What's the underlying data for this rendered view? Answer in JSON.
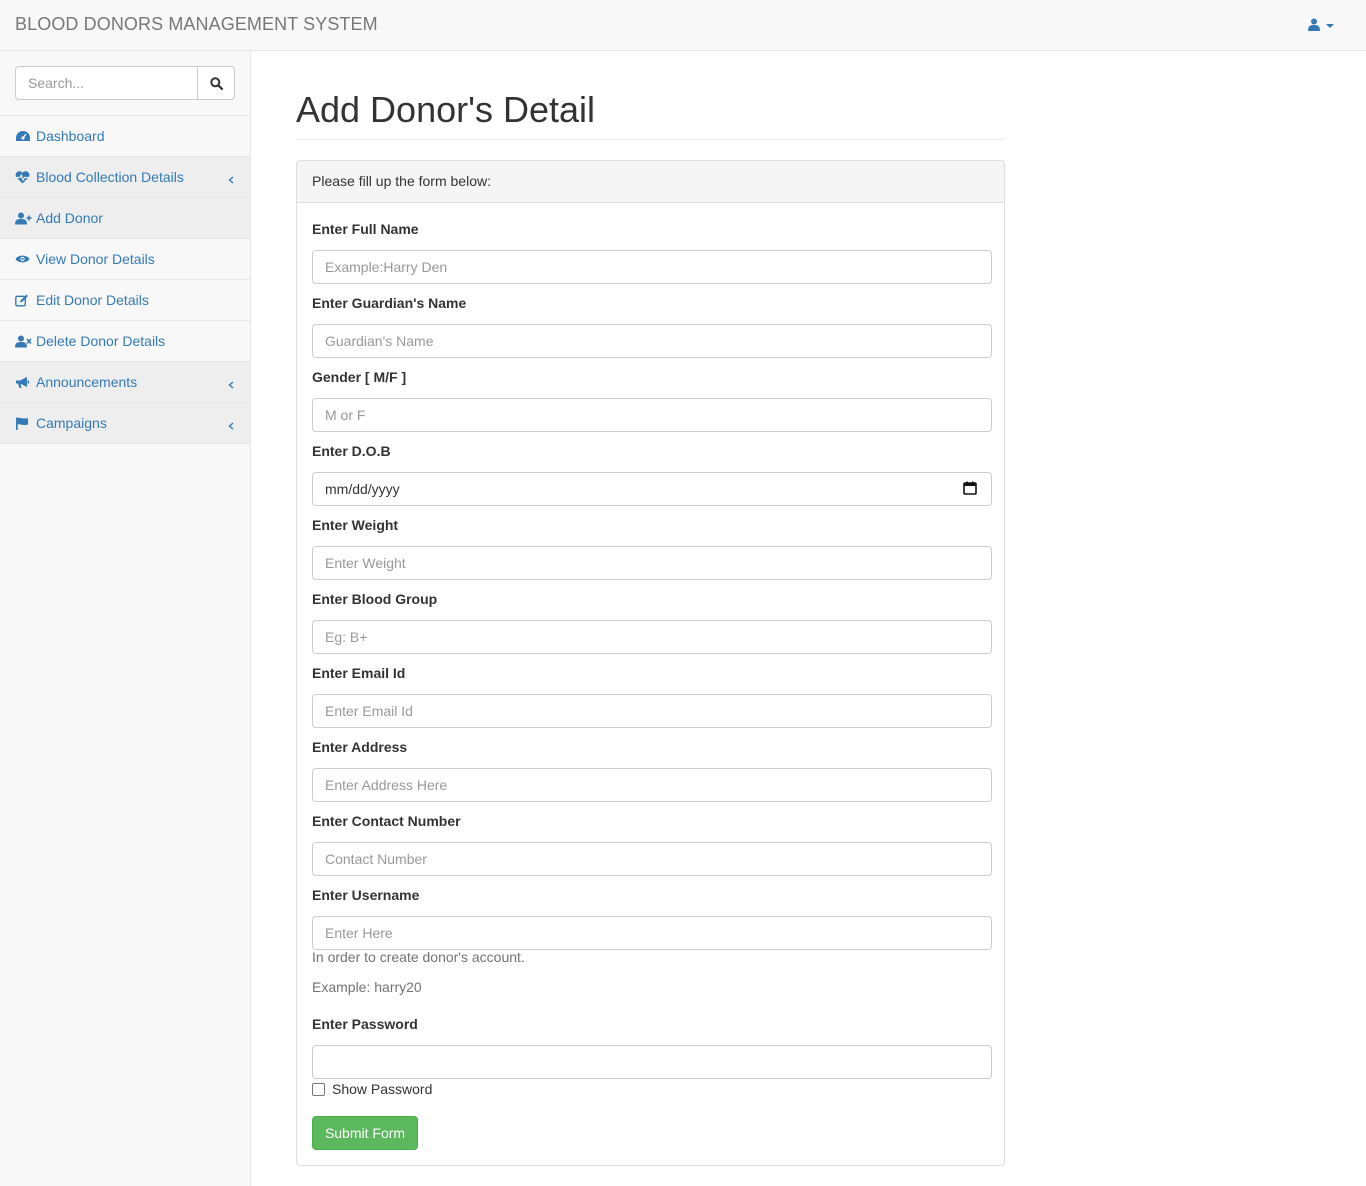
{
  "navbar": {
    "brand": "BLOOD DONORS MANAGEMENT SYSTEM",
    "user_icon": "user-icon"
  },
  "sidebar": {
    "search_placeholder": "Search...",
    "items": [
      {
        "label": "Dashboard",
        "icon": "dashboard-icon",
        "submenu": false
      },
      {
        "label": "Blood Collection Details",
        "icon": "heartbeat-icon",
        "submenu": true
      },
      {
        "label": "Add Donor",
        "icon": "user-plus-icon",
        "submenu": false
      },
      {
        "label": "View Donor Details",
        "icon": "eye-icon",
        "submenu": false
      },
      {
        "label": "Edit Donor Details",
        "icon": "edit-icon",
        "submenu": false
      },
      {
        "label": "Delete Donor Details",
        "icon": "user-times-icon",
        "submenu": false
      },
      {
        "label": "Announcements",
        "icon": "bullhorn-icon",
        "submenu": true
      },
      {
        "label": "Campaigns",
        "icon": "flag-icon",
        "submenu": true
      }
    ]
  },
  "main": {
    "title": "Add Donor's Detail",
    "panel_heading": "Please fill up the form below:",
    "fields": [
      {
        "label": "Enter Full Name",
        "placeholder": "Example:Harry Den",
        "value": ""
      },
      {
        "label": "Enter Guardian's Name",
        "placeholder": "Guardian's Name",
        "value": ""
      },
      {
        "label": "Gender [ M/F ]",
        "placeholder": "M or F",
        "value": ""
      },
      {
        "label": "Enter D.O.B",
        "placeholder": "mm/dd/yyyy",
        "value": ""
      },
      {
        "label": "Enter Weight",
        "placeholder": "Enter Weight",
        "value": ""
      },
      {
        "label": "Enter Blood Group",
        "placeholder": "Eg: B+",
        "value": ""
      },
      {
        "label": "Enter Email Id",
        "placeholder": "Enter Email Id",
        "value": ""
      },
      {
        "label": "Enter Address",
        "placeholder": "Enter Address Here",
        "value": ""
      },
      {
        "label": "Enter Contact Number",
        "placeholder": "Contact Number",
        "value": ""
      },
      {
        "label": "Enter Username",
        "placeholder": "Enter Here",
        "value": ""
      },
      {
        "label": "Enter Password",
        "placeholder": "",
        "value": ""
      }
    ],
    "username_help": [
      "In order to create donor's account.",
      "Example: harry20"
    ],
    "show_password_label": "Show Password",
    "submit_label": "Submit Form"
  },
  "colors": {
    "link": "#337ab7",
    "success": "#5cb85c",
    "navbar_bg": "#f8f8f8"
  }
}
